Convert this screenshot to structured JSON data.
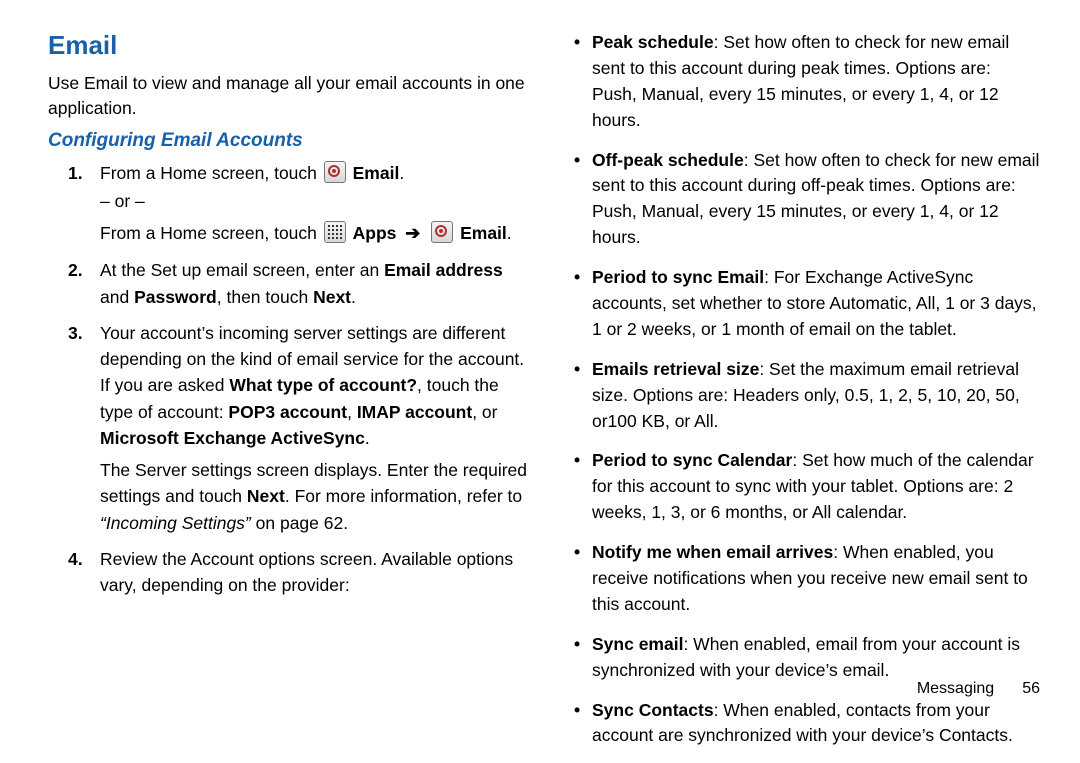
{
  "title": "Email",
  "intro": "Use Email to view and manage all your email accounts in one application.",
  "subheading": "Configuring Email Accounts",
  "steps": {
    "s1_prefix": "From a Home screen, touch ",
    "s1_email_label": "Email",
    "s1_or": "– or –",
    "s1_alt_prefix": "From a Home screen, touch ",
    "s1_apps_label": "Apps",
    "s1_arrow": "➔",
    "s2_a": "At the Set up email screen, enter an ",
    "s2_b": "Email address",
    "s2_c": " and ",
    "s2_d": "Password",
    "s2_e": ", then touch ",
    "s2_f": "Next",
    "s2_g": ".",
    "s3_a": "Your account’s incoming server settings are different depending on the kind of email service for the account. If you are asked ",
    "s3_b": "What type of account?",
    "s3_c": ", touch the type of account: ",
    "s3_d": "POP3 account",
    "s3_e": ", ",
    "s3_f": "IMAP account",
    "s3_g": ", or ",
    "s3_h": "Microsoft Exchange ActiveSync",
    "s3_i": ".",
    "s3_srv_a": "The Server settings screen displays. Enter the required settings and touch ",
    "s3_srv_b": "Next",
    "s3_srv_c": ". For more information, refer to ",
    "s3_srv_d": "“Incoming Settings”",
    "s3_srv_e": " on page 62.",
    "s4": "Review the Account options screen. Available options vary, depending on the provider:"
  },
  "options": [
    {
      "title": "Peak schedule",
      "desc": ": Set how often to check for new email sent to this account during peak times. Options are: Push, Manual, every 15 minutes, or every 1, 4, or 12 hours."
    },
    {
      "title": "Off-peak schedule",
      "desc": ": Set how often to check for new email sent to this account during off-peak times. Options are: Push, Manual, every 15 minutes, or every 1, 4, or 12 hours."
    },
    {
      "title": "Period to sync Email",
      "desc": ": For Exchange ActiveSync accounts, set whether to store Automatic, All, 1 or 3 days, 1 or 2 weeks, or 1 month of email on the tablet."
    },
    {
      "title": "Emails retrieval size",
      "desc": ": Set the maximum email retrieval size. Options are: Headers only, 0.5, 1, 2, 5, 10, 20, 50, or100 KB, or All."
    },
    {
      "title": "Period to sync Calendar",
      "desc": ": Set how much of the calendar for this account to sync with your tablet. Options are: 2 weeks, 1, 3, or 6 months, or All calendar."
    },
    {
      "title": "Notify me when email arrives",
      "desc": ": When enabled, you receive notifications when you receive new email sent to this account."
    },
    {
      "title": "Sync email",
      "desc": ": When enabled, email from your account is synchronized with your device’s email."
    },
    {
      "title": "Sync Contacts",
      "desc": ": When enabled, contacts from your account are synchronized with your device’s Contacts."
    }
  ],
  "footer": {
    "section": "Messaging",
    "page": "56"
  }
}
